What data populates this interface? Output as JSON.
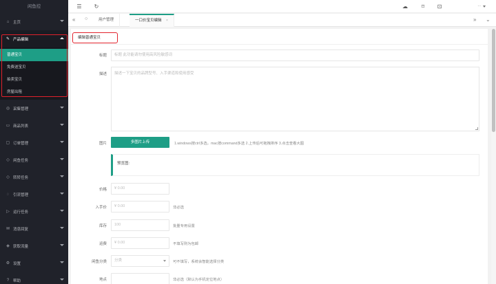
{
  "sidebar": {
    "logo": "闲鱼控",
    "items": [
      {
        "label": "主页",
        "icon": "home-icon"
      },
      {
        "label": "产品编辑",
        "icon": "edit-icon"
      },
      {
        "label": "采集管理",
        "icon": "collect-icon"
      },
      {
        "label": "商品列表",
        "icon": "list-icon"
      },
      {
        "label": "订单管理",
        "icon": "order-icon"
      },
      {
        "label": "闲鱼任务",
        "icon": "task-icon"
      },
      {
        "label": "转转任务",
        "icon": "task-icon"
      },
      {
        "label": "引流管理",
        "icon": "traffic-icon"
      },
      {
        "label": "运行任务",
        "icon": "run-icon"
      },
      {
        "label": "消息回复",
        "icon": "message-icon"
      },
      {
        "label": "获取流量",
        "icon": "flow-icon"
      },
      {
        "label": "设置",
        "icon": "gear-icon"
      },
      {
        "label": "帮助",
        "icon": "help-icon"
      }
    ],
    "sub_items": [
      "普通宝贝",
      "免费送宝贝",
      "拍卖宝贝",
      "房屋出租"
    ]
  },
  "topbar": {
    "menu_icon": "menu-icon",
    "refresh_icon": "refresh-icon",
    "user_name": "...",
    "right_icons": [
      "cloud-icon",
      "tag-icon",
      "lock-icon"
    ]
  },
  "tabs": {
    "home_icon": "home-icon",
    "items": [
      {
        "label": "用户管理",
        "active": false
      },
      {
        "label": "一口价宝贝编辑",
        "active": true
      }
    ],
    "close_symbol": "×"
  },
  "form": {
    "card_title": "编辑普通宝贝",
    "title": {
      "label": "标题",
      "placeholder": "标题 此功能请勿使用高风险敏感词"
    },
    "desc": {
      "label": "描述",
      "placeholder": "描述一下宝贝的品牌型号、入手渠道和使用感受"
    },
    "image": {
      "label": "图片",
      "button": "多图片上传",
      "hint": "1.windows按ctrl多选，mac按command多选  2.上传后可拖拽排序  3.点击查看大图",
      "preview_label": "预览图:"
    },
    "price": {
      "label": "价格",
      "placeholder": "¥ 0.00"
    },
    "cost": {
      "label": "入手价",
      "placeholder": "¥ 0.00",
      "hint": "非必选"
    },
    "stock": {
      "label": "库存",
      "placeholder": "100",
      "hint": "批量专用设置"
    },
    "postage": {
      "label": "运费",
      "placeholder": "¥ 0.00",
      "hint": "不填写则为包邮"
    },
    "category": {
      "label": "闲鱼分类",
      "placeholder": "分类",
      "hint": "可不填写，系统会智能选择分类"
    },
    "location": {
      "label": "地点",
      "placeholder": "",
      "hint": "非必选（默认为手机定位地点）"
    }
  },
  "colors": {
    "accent": "#1e9e86",
    "sidebar_bg": "#20222a",
    "highlight_border": "#e2212b"
  }
}
